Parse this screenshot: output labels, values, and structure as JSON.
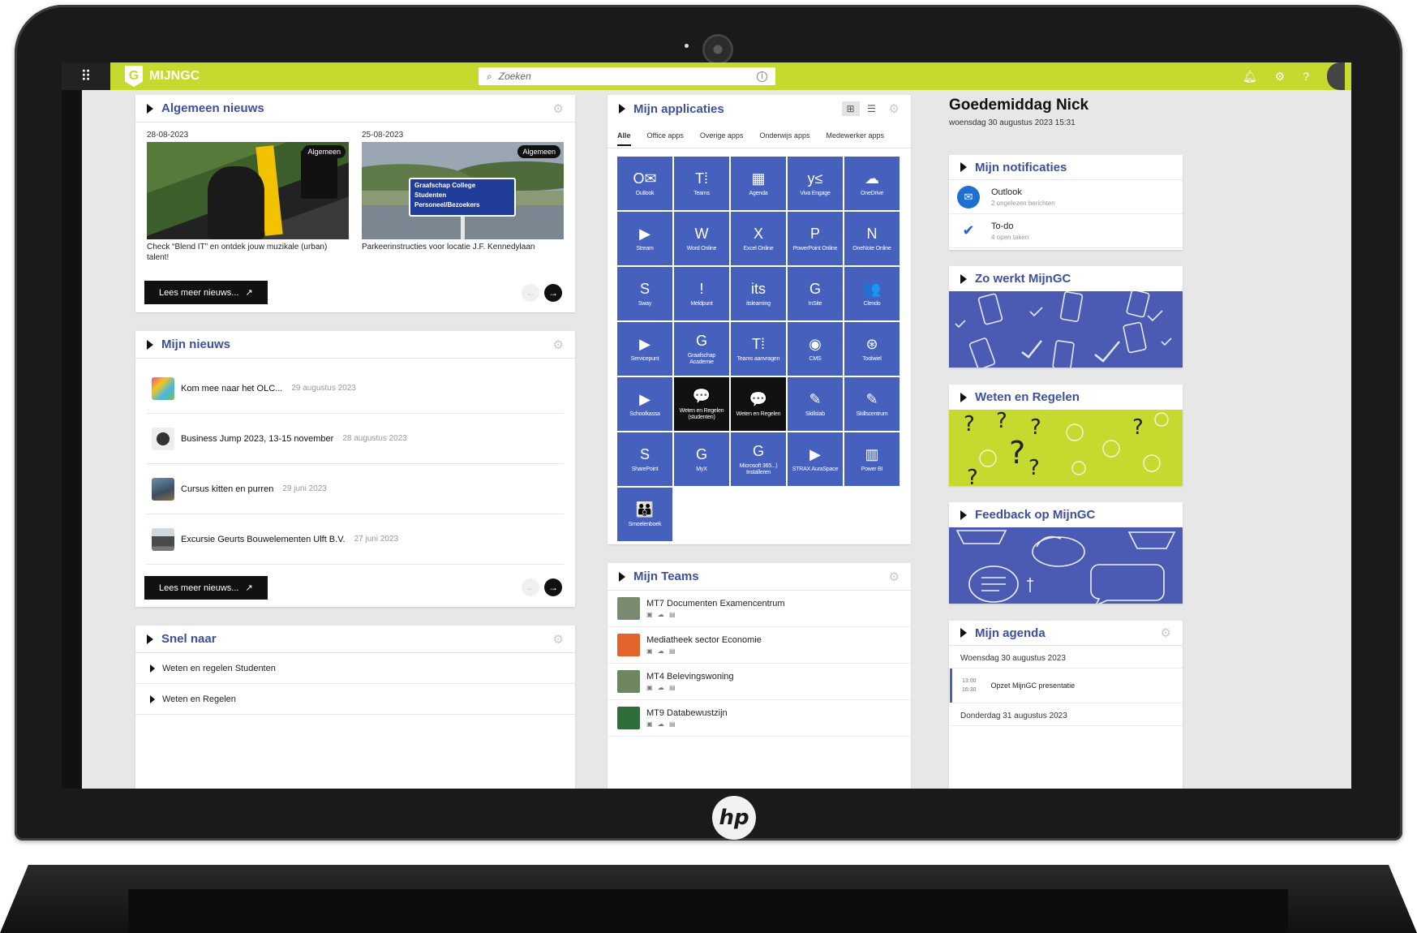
{
  "brand": {
    "name": "MIJNGC",
    "accent": "#c6d92f",
    "primary": "#4660bd",
    "title_color": "#3e4f9d",
    "device_logo": "hp"
  },
  "search": {
    "placeholder": "Zoeken"
  },
  "general_news": {
    "title": "Algemeen nieuws",
    "items": [
      {
        "date": "28-08-2023",
        "badge": "Algemeen",
        "caption": "Check “Blend IT” en ontdek jouw muzikale (urban) talent!"
      },
      {
        "date": "25-08-2023",
        "badge": "Algemeen",
        "caption": "Parkeerinstructies voor locatie J.F. Kennedylaan",
        "sign_title": "Graafschap College",
        "sign_row1": "Studenten",
        "sign_row2": "Personeel/Bezoekers"
      }
    ],
    "read_more": "Lees meer nieuws..."
  },
  "my_news": {
    "title": "Mijn nieuws",
    "items": [
      {
        "title": "Kom mee naar het OLC...",
        "date": "29 augustus 2023"
      },
      {
        "title": "Business Jump 2023, 13-15 november",
        "date": "28 augustus 2023"
      },
      {
        "title": "Cursus kitten en purren",
        "date": "29 juni 2023"
      },
      {
        "title": "Excursie Geurts Bouwelementen Ulft B.V.",
        "date": "27 juni 2023"
      }
    ],
    "read_more": "Lees meer nieuws..."
  },
  "quick_links": {
    "title": "Snel naar",
    "items": [
      "Weten en regelen Studenten",
      "Weten en Regelen"
    ]
  },
  "apps": {
    "title": "Mijn applicaties",
    "tabs": [
      "Alle",
      "Office apps",
      "Overige apps",
      "Onderwijs apps",
      "Medewerker apps"
    ],
    "tiles": [
      {
        "label": "Outlook",
        "icon": "outlook-icon",
        "glyph": "O✉"
      },
      {
        "label": "Teams",
        "icon": "teams-icon",
        "glyph": "T⁞"
      },
      {
        "label": "Agenda",
        "icon": "calendar-icon",
        "glyph": "▦"
      },
      {
        "label": "Viva Engage",
        "icon": "viva-engage-icon",
        "glyph": "y≤"
      },
      {
        "label": "OneDrive",
        "icon": "onedrive-icon",
        "glyph": "☁"
      },
      {
        "label": "Stream",
        "icon": "stream-icon",
        "glyph": "▶"
      },
      {
        "label": "Word Online",
        "icon": "word-icon",
        "glyph": "W"
      },
      {
        "label": "Excel Online",
        "icon": "excel-icon",
        "glyph": "X"
      },
      {
        "label": "PowerPoint Online",
        "icon": "powerpoint-icon",
        "glyph": "P"
      },
      {
        "label": "OneNote Online",
        "icon": "onenote-icon",
        "glyph": "N"
      },
      {
        "label": "Sway",
        "icon": "sway-icon",
        "glyph": "S"
      },
      {
        "label": "Meldpunt",
        "icon": "alert-icon",
        "glyph": "!"
      },
      {
        "label": "itslearning",
        "icon": "itslearning-icon",
        "glyph": "its"
      },
      {
        "label": "InSite",
        "icon": "insite-icon",
        "glyph": "G"
      },
      {
        "label": "Clendo",
        "icon": "people-icon",
        "glyph": "👥"
      },
      {
        "label": "Servicepunt",
        "icon": "play-icon",
        "glyph": "▶"
      },
      {
        "label": "Graafschap Academie",
        "icon": "gc-icon",
        "glyph": "G"
      },
      {
        "label": "Teams aanvragen",
        "icon": "teams-request-icon",
        "glyph": "T⁞"
      },
      {
        "label": "CMS",
        "icon": "cms-icon",
        "glyph": "◉"
      },
      {
        "label": "Toolwiel",
        "icon": "wheel-icon",
        "glyph": "⊛"
      },
      {
        "label": "Schoolkassa",
        "icon": "play-icon",
        "glyph": "▶"
      },
      {
        "label": "Weten en Regelen (studenten)",
        "icon": "chat-icon",
        "glyph": "💬",
        "dark": true
      },
      {
        "label": "Weten en Regelen",
        "icon": "chat-icon",
        "glyph": "💬",
        "dark": true
      },
      {
        "label": "Skillslab",
        "icon": "pen-icon",
        "glyph": "✎"
      },
      {
        "label": "Skillscentrum",
        "icon": "pen-icon",
        "glyph": "✎"
      },
      {
        "label": "SharePoint",
        "icon": "sharepoint-icon",
        "glyph": "S"
      },
      {
        "label": "MyX",
        "icon": "gc-icon",
        "glyph": "G"
      },
      {
        "label": "Microsoft 365...) Installeren",
        "icon": "gc-icon",
        "glyph": "G"
      },
      {
        "label": "STRAX AuraSpace",
        "icon": "play-icon",
        "glyph": "▶"
      },
      {
        "label": "Power BI",
        "icon": "powerbi-icon",
        "glyph": "▥"
      },
      {
        "label": "Smoelenboek",
        "icon": "group-icon",
        "glyph": "👪"
      }
    ]
  },
  "teams": {
    "title": "Mijn Teams",
    "items": [
      {
        "name": "MT7 Documenten Examencentrum",
        "thumb": "#7a8a70"
      },
      {
        "name": "Mediatheek sector Economie",
        "thumb": "#e2642a"
      },
      {
        "name": "MT4 Belevingswoning",
        "thumb": "#6d8660"
      },
      {
        "name": "MT9 Databewustzijn",
        "thumb": "#2f6e3b"
      }
    ]
  },
  "greeting": {
    "title": "Goedemiddag Nick",
    "datetime": "woensdag 30 augustus 2023 15:31"
  },
  "notifications": {
    "title": "Mijn notificaties",
    "items": [
      {
        "title": "Outlook",
        "sub": "2 ongelezen berichten",
        "icon": "mail-icon"
      },
      {
        "title": "To-do",
        "sub": "4 open taken",
        "icon": "check-icon"
      }
    ]
  },
  "promos": [
    {
      "title": "Zo werkt MijnGC"
    },
    {
      "title": "Weten en Regelen"
    },
    {
      "title": "Feedback op MijnGC"
    }
  ],
  "agenda": {
    "title": "Mijn agenda",
    "day": "Woensdag 30 augustus 2023",
    "items": [
      {
        "start": "13:00",
        "end": "16:30",
        "title": "Opzet MijnGC presentatie"
      }
    ],
    "next_day": "Donderdag 31 augustus 2023"
  }
}
